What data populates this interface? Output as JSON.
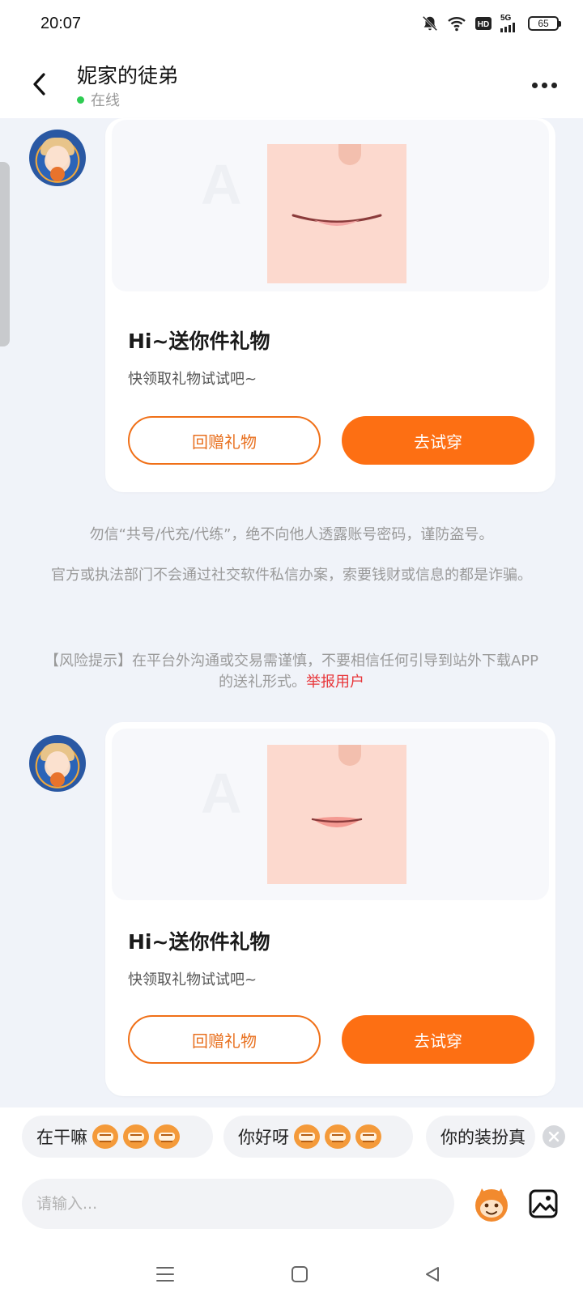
{
  "status_bar": {
    "time": "20:07",
    "network": "5G",
    "hd_label": "HD",
    "battery": "65",
    "icons": [
      "mute-bell-icon",
      "wifi-icon",
      "hd-icon",
      "signal-icon",
      "battery-icon"
    ]
  },
  "header": {
    "title": "妮家的徒弟",
    "status": "在线",
    "status_color": "#2ecc52"
  },
  "messages": [
    {
      "title": "Hi~送你件礼物",
      "subtitle": "快领取礼物试试吧~",
      "return_gift_label": "回赠礼物",
      "try_on_label": "去试穿"
    },
    {
      "title": "Hi~送你件礼物",
      "subtitle": "快领取礼物试试吧~",
      "return_gift_label": "回赠礼物",
      "try_on_label": "去试穿"
    }
  ],
  "notices": {
    "line1": "勿信“共号/代充/代练”，绝不向他人透露账号密码，谨防盗号。",
    "line2": "官方或执法部门不会通过社交软件私信办案，索要钱财或信息的都是诈骗。",
    "risk": "【风险提示】在平台外沟通或交易需谨慎，不要相信任何引导到站外下载APP的送礼形式。",
    "report_link": "举报用户",
    "report_color": "#e8363a"
  },
  "quick_replies": [
    {
      "label": "在干嘛"
    },
    {
      "label": "你好呀"
    },
    {
      "label": "你的装扮真"
    }
  ],
  "input": {
    "placeholder": "请输入..."
  },
  "colors": {
    "accent": "#fd6f13",
    "background": "#f0f3f9"
  }
}
